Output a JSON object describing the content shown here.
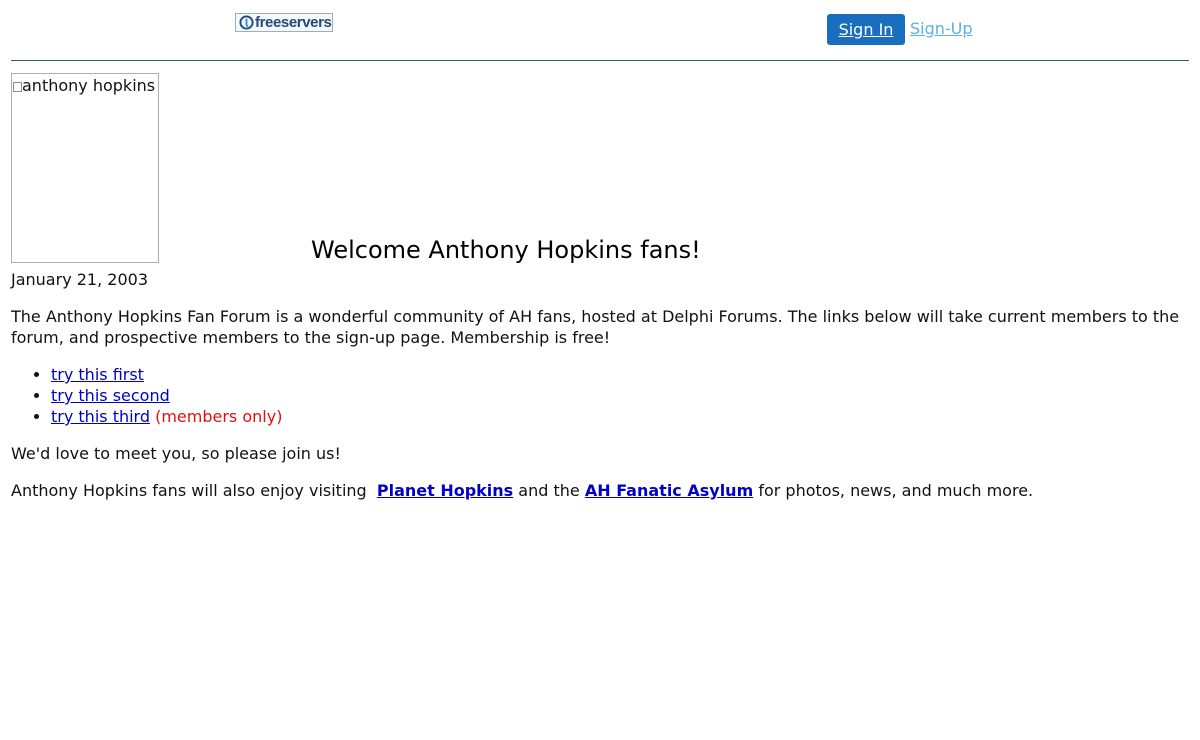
{
  "header": {
    "logo_text": "freeservers",
    "sign_in_label": "Sign In",
    "sign_up_label": "Sign-Up"
  },
  "main": {
    "image_alt": "anthony hopkins",
    "title": "Welcome Anthony Hopkins fans!",
    "date": "January 21, 2003",
    "intro": "The Anthony Hopkins Fan Forum is a wonderful community of AH fans, hosted at Delphi Forums. The links below will take current members to the forum, and prospective members to the sign-up page. Membership is free!",
    "forum_links": [
      {
        "label": "try this first",
        "note": ""
      },
      {
        "label": "try this second",
        "note": ""
      },
      {
        "label": "try this third",
        "note": "(members only)"
      }
    ],
    "join_text": "We'd love to meet you, so please join us!",
    "also_prefix": "Anthony Hopkins fans will also enjoy visiting",
    "planet_link": "Planet Hopkins",
    "also_middle": "and the",
    "asylum_link": "AH Fanatic Asylum",
    "also_suffix": "for photos, news, and much more."
  },
  "colors": {
    "link": "#0000cc",
    "sign_in_bg": "#1a6ec0",
    "sign_up_link": "#5ab2de",
    "members_only": "#e01010",
    "divider": "#3a5878"
  }
}
